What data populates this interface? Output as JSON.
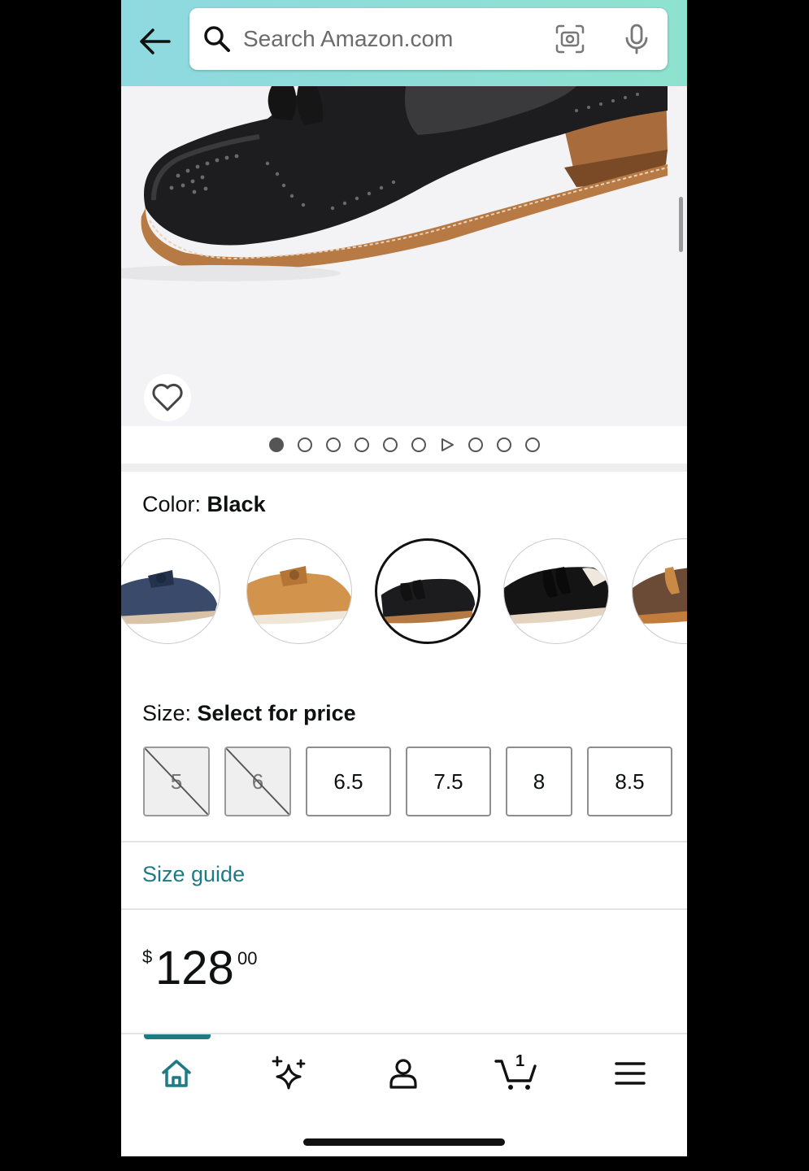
{
  "search": {
    "placeholder": "Search Amazon.com"
  },
  "gallery": {
    "image_count": 10,
    "active_index": 0
  },
  "color": {
    "label": "Color: ",
    "value": "Black"
  },
  "size": {
    "label": "Size: ",
    "value": "Select for price",
    "options": [
      {
        "label": "5",
        "available": false
      },
      {
        "label": "6",
        "available": false
      },
      {
        "label": "6.5",
        "available": true
      },
      {
        "label": "7.5",
        "available": true
      },
      {
        "label": "8",
        "available": true
      },
      {
        "label": "8.5",
        "available": true
      }
    ]
  },
  "size_guide": "Size guide",
  "price": {
    "symbol": "$",
    "whole": "128",
    "fraction": "00"
  },
  "cart": {
    "count": "1"
  },
  "colors": {
    "accent": "#1e7b86",
    "header_start": "#8fd9e0",
    "header_end": "#8de2cf"
  }
}
